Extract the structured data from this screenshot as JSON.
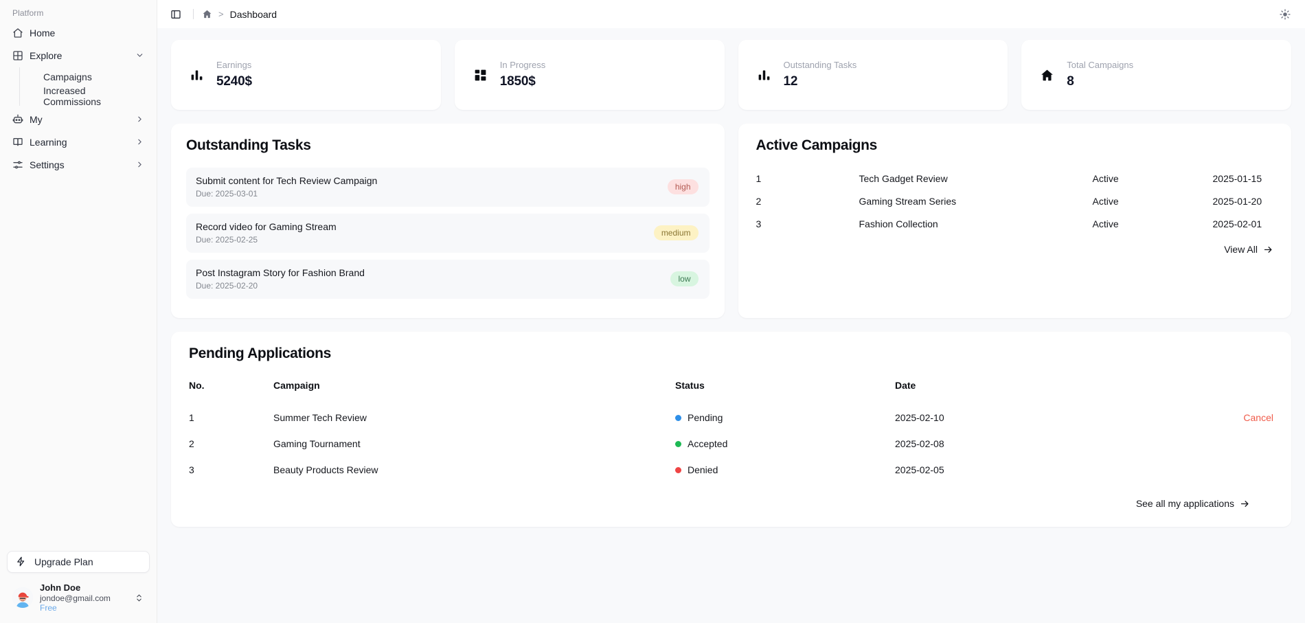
{
  "sidebar": {
    "section_label": "Platform",
    "items": [
      {
        "label": "Home",
        "icon": "home-icon",
        "chevron": "none"
      },
      {
        "label": "Explore",
        "icon": "grid-icon",
        "chevron": "chevron-down-icon"
      },
      {
        "label": "My",
        "icon": "robot-icon",
        "chevron": "chevron-right-icon"
      },
      {
        "label": "Learning",
        "icon": "book-icon",
        "chevron": "chevron-right-icon"
      },
      {
        "label": "Settings",
        "icon": "sliders-icon",
        "chevron": "chevron-right-icon"
      }
    ],
    "explore_subitems": [
      {
        "label": "Campaigns"
      },
      {
        "label": "Increased Commissions"
      }
    ],
    "upgrade": {
      "label": "Upgrade Plan",
      "icon": "lightning-icon"
    },
    "user": {
      "name": "John Doe",
      "email": "jondoe@gmail.com",
      "plan": "Free",
      "avatar": "user-avatar",
      "chevron": "chevron-up-down-icon"
    }
  },
  "topbar": {
    "sidebar_toggle_icon": "panel-toggle-icon",
    "home_icon": "home-icon",
    "separator": ">",
    "breadcrumb_current": "Dashboard",
    "theme_toggle_icon": "sun-icon"
  },
  "stats": [
    {
      "label": "Earnings",
      "value": "5240$",
      "icon": "bar-chart-icon"
    },
    {
      "label": "In Progress",
      "value": "1850$",
      "icon": "layout-grid-icon"
    },
    {
      "label": "Outstanding Tasks",
      "value": "12",
      "icon": "bar-chart-icon"
    },
    {
      "label": "Total Campaigns",
      "value": "8",
      "icon": "home-filled-icon"
    }
  ],
  "outstanding_tasks": {
    "title": "Outstanding Tasks",
    "items": [
      {
        "name": "Submit content for Tech Review Campaign",
        "due": "Due: 2025-03-01",
        "priority": "high"
      },
      {
        "name": "Record video for Gaming Stream",
        "due": "Due: 2025-02-25",
        "priority": "medium"
      },
      {
        "name": "Post Instagram Story for Fashion Brand",
        "due": "Due: 2025-02-20",
        "priority": "low"
      }
    ]
  },
  "active_campaigns": {
    "title": "Active Campaigns",
    "rows": [
      {
        "no": "1",
        "name": "Tech Gadget Review",
        "status": "Active",
        "date": "2025-01-15"
      },
      {
        "no": "2",
        "name": "Gaming Stream Series",
        "status": "Active",
        "date": "2025-01-20"
      },
      {
        "no": "3",
        "name": "Fashion Collection",
        "status": "Active",
        "date": "2025-02-01"
      }
    ],
    "view_all": "View All",
    "view_all_icon": "arrow-right-icon"
  },
  "pending_applications": {
    "title": "Pending Applications",
    "columns": {
      "no": "No.",
      "campaign": "Campaign",
      "status": "Status",
      "date": "Date",
      "action": ""
    },
    "rows": [
      {
        "no": "1",
        "campaign": "Summer Tech Review",
        "status": "Pending",
        "status_color": "#2e8fe8",
        "date": "2025-02-10",
        "action": "Cancel"
      },
      {
        "no": "2",
        "campaign": "Gaming Tournament",
        "status": "Accepted",
        "status_color": "#1db954",
        "date": "2025-02-08",
        "action": ""
      },
      {
        "no": "3",
        "campaign": "Beauty Products Review",
        "status": "Denied",
        "status_color": "#ef4444",
        "date": "2025-02-05",
        "action": ""
      }
    ],
    "footer_link": "See all my applications",
    "footer_icon": "arrow-right-icon"
  },
  "colors": {
    "page_background": "#f8f9fb",
    "sidebar_background": "#fafafa",
    "card_background": "#ffffff",
    "accent_cancel": "#f05b4a",
    "plan_text": "#6aa9e9",
    "badge_high_bg": "#fde0e0",
    "badge_medium_bg": "#fdf2c4",
    "badge_low_bg": "#d8f5e0"
  }
}
